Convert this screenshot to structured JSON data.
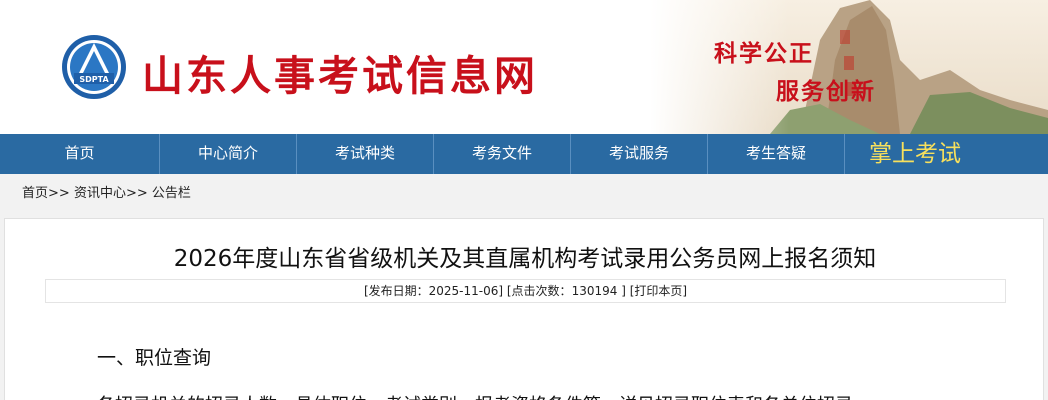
{
  "header": {
    "site_title": "山东人事考试信息网",
    "logo_text": "SDPTA",
    "slogan_line1": "科学公正",
    "slogan_line2": "服务创新"
  },
  "nav": {
    "items": [
      {
        "label": "首页"
      },
      {
        "label": "中心简介"
      },
      {
        "label": "考试种类"
      },
      {
        "label": "考务文件"
      },
      {
        "label": "考试服务"
      },
      {
        "label": "考生答疑"
      }
    ],
    "mobile_label": "掌上考试"
  },
  "breadcrumb": {
    "home": "首页",
    "sep1": ">>",
    "level2": "资讯中心",
    "sep2": ">>",
    "level3": "公告栏"
  },
  "article": {
    "title": "2026年度山东省省级机关及其直属机构考试录用公务员网上报名须知",
    "meta_prefix": "[发布日期：",
    "publish_date": "2025-11-06",
    "meta_mid": "] [点击次数：",
    "click_count": "130194",
    "meta_end": " ] ",
    "print_label": "[打印本页]",
    "section1_heading": "一、职位查询",
    "para1": "各招录机关的招录人数、具体职位、考试类别、报考资格条件等，详见招录职位表和各单位招录"
  },
  "colors": {
    "brand_red": "#c8101b",
    "nav_blue": "#2a6aa2",
    "mobile_yellow": "#f8e05c"
  }
}
